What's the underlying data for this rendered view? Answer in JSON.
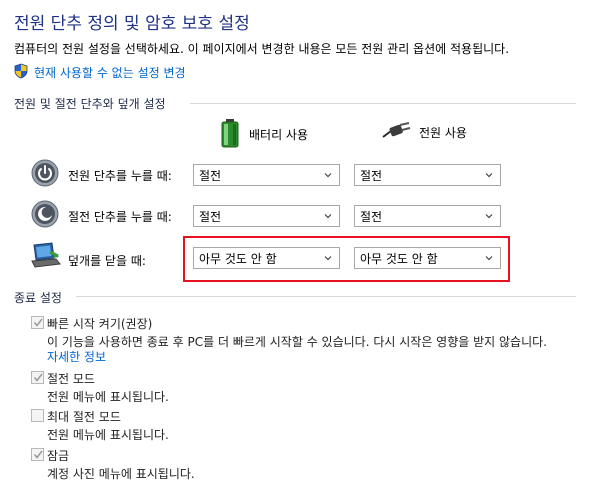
{
  "header": {
    "title": "전원 단추 정의 및 암호 보호 설정",
    "subtitle": "컴퓨터의 전원 설정을 선택하세요. 이 페이지에서 변경한 내용은 모든 전원 관리 옵션에 적용됩니다.",
    "change_link": "현재 사용할 수 없는 설정 변경"
  },
  "buttons_section": {
    "heading": "전원 및 절전 단추와 덮개 설정",
    "battery_label": "배터리 사용",
    "plugged_label": "전원 사용",
    "rows": [
      {
        "label": "전원 단추를 누를 때:",
        "battery": "절전",
        "plugged": "절전"
      },
      {
        "label": "절전 단추를 누를 때:",
        "battery": "절전",
        "plugged": "절전"
      },
      {
        "label": "덮개를 닫을 때:",
        "battery": "아무 것도 안 함",
        "plugged": "아무 것도 안 함"
      }
    ]
  },
  "shutdown_section": {
    "heading": "종료 설정",
    "options": [
      {
        "label": "빠른 시작 켜기(권장)",
        "desc": "이 기능을 사용하면 종료 후 PC를 더 빠르게 시작할 수 있습니다. 다시 시작은 영향을 받지 않습니다.",
        "link": "자세한 정보",
        "checked": true
      },
      {
        "label": "절전 모드",
        "desc": "전원 메뉴에 표시됩니다.",
        "checked": true
      },
      {
        "label": "최대 절전 모드",
        "desc": "전원 메뉴에 표시됩니다.",
        "checked": false
      },
      {
        "label": "잠금",
        "desc": "계정 사진 메뉴에 표시됩니다.",
        "checked": true
      }
    ]
  },
  "colors": {
    "title": "#1e3287",
    "link": "#0066cc",
    "highlight": "#e81123"
  }
}
